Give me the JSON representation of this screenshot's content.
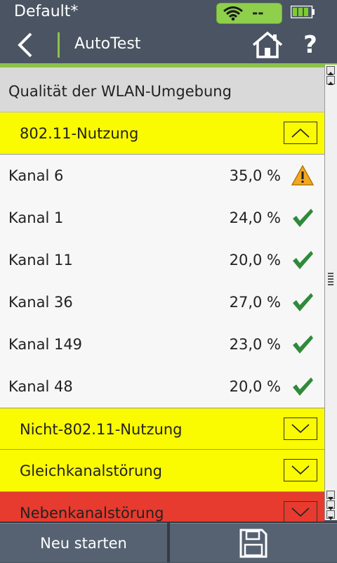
{
  "status_bar": {
    "profile": "Default*",
    "wifi_status": "--",
    "wifi_icon": "wifi-icon",
    "battery_icon": "battery-icon"
  },
  "title_bar": {
    "back_icon": "chevron-left-icon",
    "title": "AutoTest",
    "home_icon": "home-icon",
    "help": "?"
  },
  "section": {
    "title": "Qualität der WLAN-Umgebung"
  },
  "groups": [
    {
      "label": "802.11-Nutzung",
      "color": "#fafa00",
      "expanded": true
    },
    {
      "label": "Nicht-802.11-Nutzung",
      "color": "#fafa00",
      "expanded": false
    },
    {
      "label": "Gleichkanalstörung",
      "color": "#fafa00",
      "expanded": false
    },
    {
      "label": "Nebenkanalstörung",
      "color": "#e63b2e",
      "expanded": false
    }
  ],
  "channels": [
    {
      "name": "Kanal 6",
      "value": "35,0 %",
      "status": "warning"
    },
    {
      "name": "Kanal 1",
      "value": "24,0 %",
      "status": "pass"
    },
    {
      "name": "Kanal 11",
      "value": "20,0 %",
      "status": "pass"
    },
    {
      "name": "Kanal 36",
      "value": "27,0 %",
      "status": "pass"
    },
    {
      "name": "Kanal 149",
      "value": "23,0 %",
      "status": "pass"
    },
    {
      "name": "Kanal 48",
      "value": "20,0 %",
      "status": "pass"
    }
  ],
  "bottom_bar": {
    "restart_label": "Neu starten",
    "save_icon": "floppy-disk-icon"
  },
  "colors": {
    "accent": "#8bc34a",
    "warning": "#f5a623",
    "pass": "#2e8b3a",
    "yellow_group": "#fafa00",
    "red_group": "#e63b2e"
  }
}
